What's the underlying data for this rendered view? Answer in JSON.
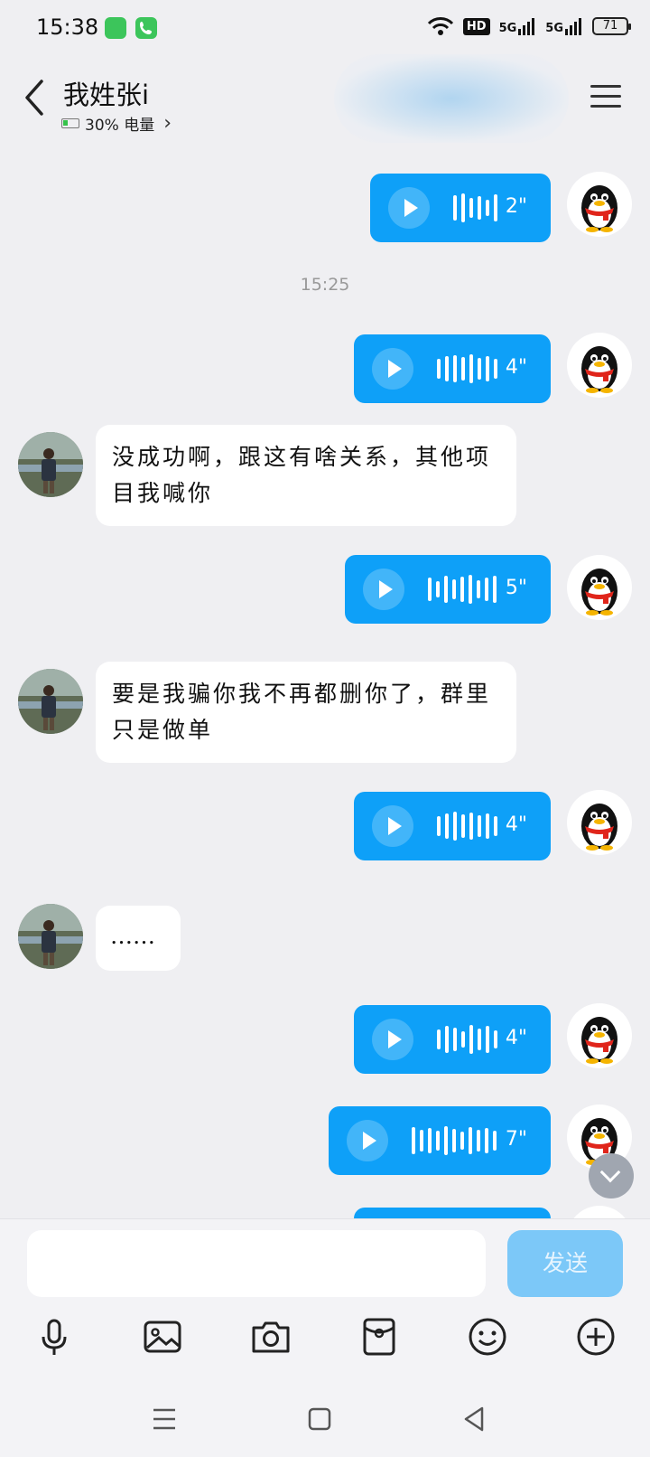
{
  "status_bar": {
    "time": "15:38",
    "hd_label": "HD",
    "signal1": "5G",
    "signal2": "5G",
    "battery": "71"
  },
  "header": {
    "contact_name": "我姓张i",
    "battery_info": "30% 电量",
    "chevron": "›"
  },
  "chat": {
    "timestamp": "15:25",
    "messages": [
      {
        "type": "voice",
        "side": "right",
        "duration": "2\""
      },
      {
        "type": "voice",
        "side": "right",
        "duration": "4\""
      },
      {
        "type": "text",
        "side": "left",
        "text": "没成功啊，跟这有啥关系，其他项目我喊你"
      },
      {
        "type": "voice",
        "side": "right",
        "duration": "5\""
      },
      {
        "type": "text",
        "side": "left",
        "text": "要是我骗你我不再都删你了，群里只是做单"
      },
      {
        "type": "voice",
        "side": "right",
        "duration": "4\""
      },
      {
        "type": "text",
        "side": "left",
        "text": "……"
      },
      {
        "type": "voice",
        "side": "right",
        "duration": "4\""
      },
      {
        "type": "voice",
        "side": "right",
        "duration": "7\""
      }
    ]
  },
  "input": {
    "placeholder": "",
    "send_label": "发送"
  },
  "toolbar": [
    "microphone-icon",
    "image-icon",
    "camera-icon",
    "red-packet-icon",
    "emoji-icon",
    "plus-icon"
  ],
  "colors": {
    "bubble_blue": "#0ea0f8",
    "send_disabled": "#7cc8f8",
    "background": "#efeff2"
  }
}
